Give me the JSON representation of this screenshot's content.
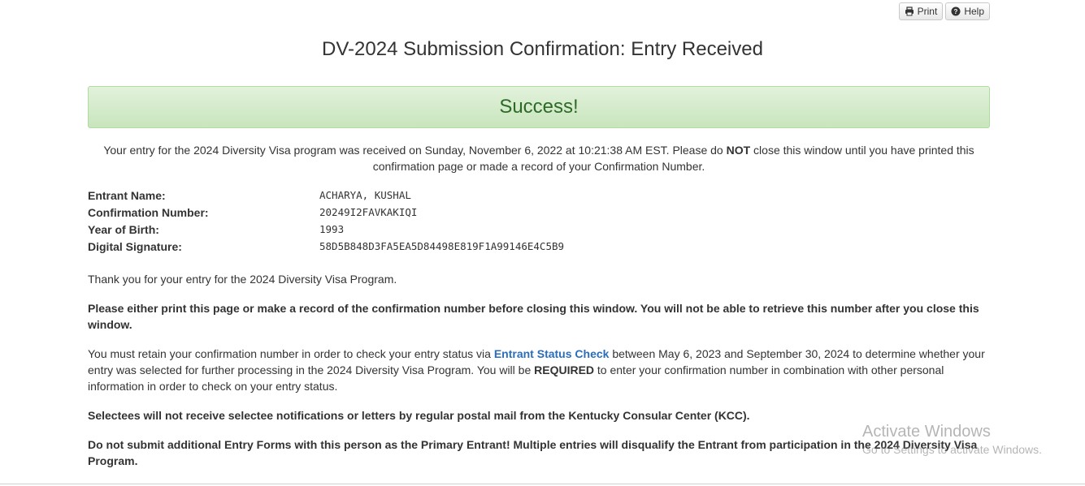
{
  "toolbar": {
    "print_label": "Print",
    "help_label": "Help"
  },
  "page_title": "DV-2024 Submission Confirmation: Entry Received",
  "success_banner": "Success!",
  "intro": {
    "part1": "Your entry for the 2024 Diversity Visa program was received on Sunday, November 6, 2022 at 10:21:38 AM EST. Please do ",
    "emphasis": "NOT",
    "part2": " close this window until you have printed this confirmation page or made a record of your Confirmation Number."
  },
  "details": [
    {
      "label": "Entrant Name:",
      "value": "ACHARYA, KUSHAL"
    },
    {
      "label": "Confirmation Number:",
      "value": "20249I2FAVKAKIQI"
    },
    {
      "label": "Year of Birth:",
      "value": "1993"
    },
    {
      "label": "Digital Signature:",
      "value": "58D5B848D3FA5EA5D84498E819F1A99146E4C5B9"
    }
  ],
  "thanks": "Thank you for your entry for the 2024 Diversity Visa Program.",
  "print_warning": "Please either print this page or make a record of the confirmation number before closing this window. You will not be able to retrieve this number after you close this window.",
  "retain": {
    "part1": "You must retain your confirmation number in order to check your entry status via ",
    "link": "Entrant Status Check",
    "part2": " between May 6, 2023 and September 30, 2024 to determine whether your entry was selected for further processing in the 2024 Diversity Visa Program. You will be ",
    "emphasis": "REQUIRED",
    "part3": " to enter your confirmation number in combination with other personal information in order to check on your entry status."
  },
  "selectees_notice": "Selectees will not receive selectee notifications or letters by regular postal mail from the Kentucky Consular Center (KCC).",
  "multiple_entries_warning": "Do not submit additional Entry Forms with this person as the Primary Entrant! Multiple entries will disqualify the Entrant from participation in the 2024 Diversity Visa Program.",
  "watermark": {
    "line1": "Activate Windows",
    "line2": "Go to Settings to activate Windows."
  },
  "icons": {
    "print": "printer-icon",
    "help": "question-circle-icon"
  }
}
